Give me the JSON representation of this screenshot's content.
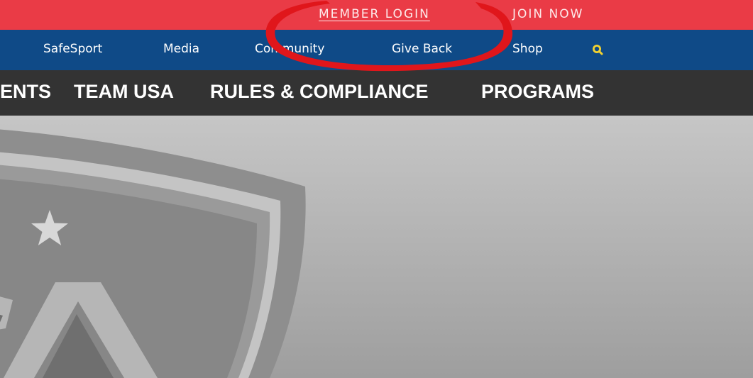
{
  "utility_bar": {
    "member_login": "MEMBER LOGIN",
    "join_now": "JOIN NOW"
  },
  "secondary_nav": {
    "items": [
      "SafeSport",
      "Media",
      "Community",
      "Give Back",
      "Shop"
    ],
    "search_icon": "search-icon"
  },
  "main_nav": {
    "items": [
      "EVENTS",
      "TEAM USA",
      "RULES & COMPLIANCE",
      "PROGRAMS"
    ]
  },
  "colors": {
    "top_bar": "#ea3b46",
    "nav_bar": "#0f4a87",
    "main_nav": "#333333",
    "search_icon": "#f2d230",
    "annotation": "#e0161b"
  }
}
